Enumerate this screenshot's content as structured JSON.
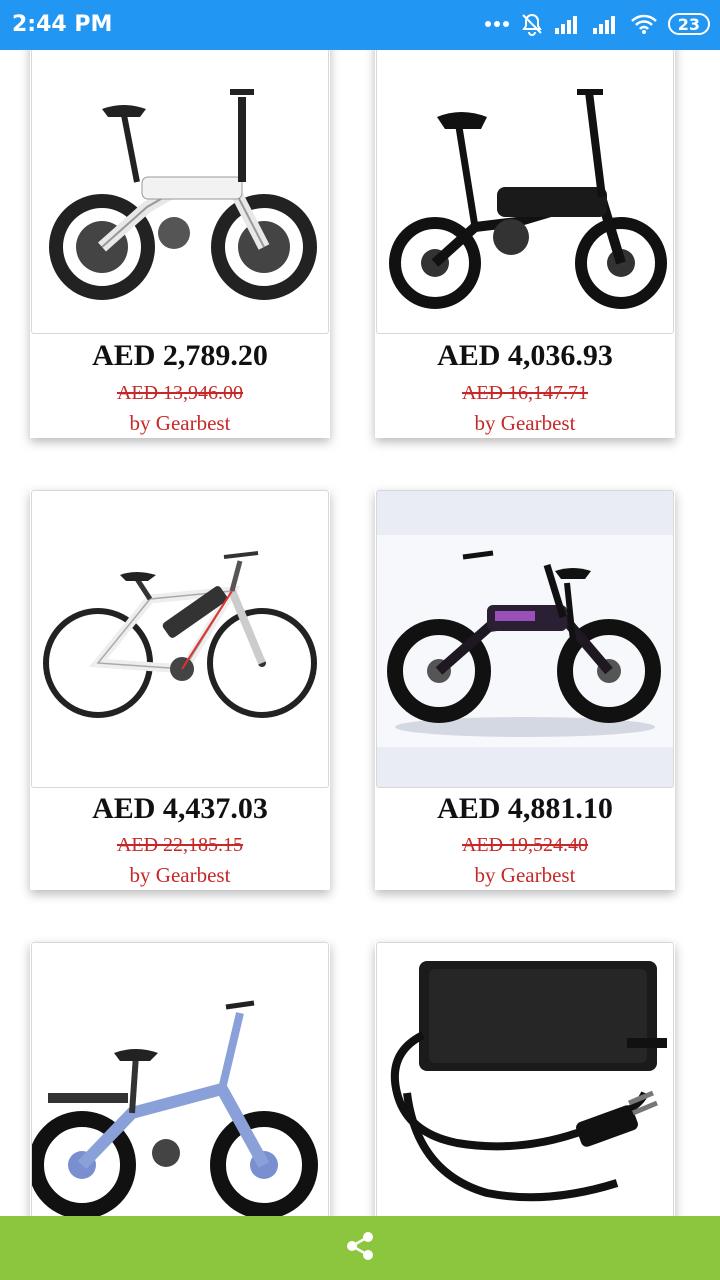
{
  "status_bar": {
    "time": "2:44 PM",
    "battery": "23",
    "icons": [
      "more-dots-icon",
      "alarm-off-icon",
      "signal-icon",
      "signal-icon",
      "wifi-icon",
      "battery-icon"
    ]
  },
  "products": [
    {
      "price": "AED 2,789.20",
      "old_price": "AED 13,946.00",
      "seller": "by Gearbest",
      "image": "white-folding-ebike"
    },
    {
      "price": "AED 4,036.93",
      "old_price": "AED 16,147.71",
      "seller": "by Gearbest",
      "image": "black-folding-ebike"
    },
    {
      "price": "AED 4,437.03",
      "old_price": "AED 22,185.15",
      "seller": "by Gearbest",
      "image": "white-mountain-ebike"
    },
    {
      "price": "AED 4,881.10",
      "old_price": "AED 19,524.40",
      "seller": "by Gearbest",
      "image": "fat-tire-folding-ebike"
    },
    {
      "price": "",
      "old_price": "",
      "seller": "",
      "image": "blue-fat-tire-ebike"
    },
    {
      "price": "",
      "old_price": "",
      "seller": "",
      "image": "power-adapter-charger"
    }
  ],
  "bottom_bar": {
    "share_icon": "share-icon",
    "color": "#8cc63f"
  },
  "colors": {
    "status_bar": "#2196f3",
    "price_strike": "#c62828",
    "seller": "#c62828"
  }
}
